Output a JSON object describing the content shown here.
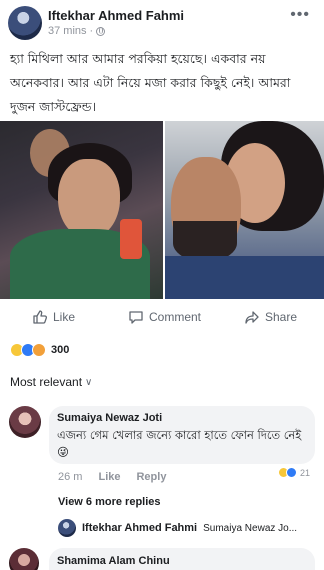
{
  "post": {
    "author": "Iftekhar Ahmed Fahmi",
    "time": "37 mins",
    "separator": "·",
    "more": "•••",
    "text": "হ্যা মিথিলা আর আমার পরকিয়া হয়েছে। একবার নয় অনেকবার। আর এটা নিয়ে মজা করার কিছুই নেই। আমরা দুজন জাস্টফ্রেন্ড।"
  },
  "actions": {
    "like": "Like",
    "comment": "Comment",
    "share": "Share"
  },
  "reactions": {
    "count": "300"
  },
  "sort": {
    "label": "Most relevant"
  },
  "comment": {
    "author": "Sumaiya Newaz Joti",
    "text": "এজন্য গেম খেলার জন্যে কারো হাতে ফোন দিতে নেই😜",
    "time": "26 m",
    "like": "Like",
    "reply": "Reply",
    "reaction_count": "21",
    "view_more": "View 6 more replies"
  },
  "reply": {
    "author": "Iftekhar Ahmed Fahmi",
    "preview": "Sumaiya Newaz Jo..."
  },
  "comment2": {
    "author": "Shamima Alam Chinu"
  },
  "colors": {
    "text": "#1c1e21",
    "meta": "#90949c",
    "bubble": "#f2f3f5",
    "like_blue": "#2f7bf6"
  }
}
